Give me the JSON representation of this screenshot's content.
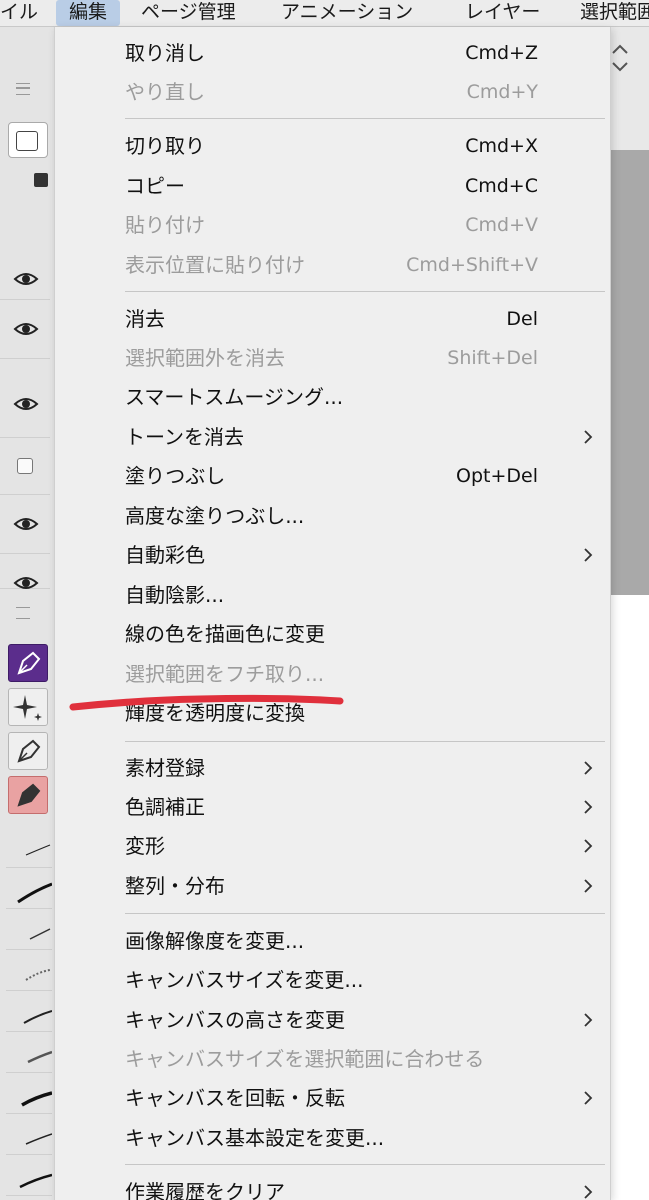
{
  "menubar": {
    "items": [
      {
        "label": "イル"
      },
      {
        "label": "編集",
        "active": true
      },
      {
        "label": "ページ管理"
      },
      {
        "label": "アニメーション"
      },
      {
        "label": "レイヤー"
      },
      {
        "label": "選択範囲"
      }
    ]
  },
  "edit_menu": {
    "items": [
      {
        "label": "取り消し",
        "shortcut": "Cmd+Z",
        "enabled": true
      },
      {
        "label": "やり直し",
        "shortcut": "Cmd+Y",
        "enabled": false
      },
      {
        "label": "切り取り",
        "shortcut": "Cmd+X",
        "enabled": true
      },
      {
        "label": "コピー",
        "shortcut": "Cmd+C",
        "enabled": true
      },
      {
        "label": "貼り付け",
        "shortcut": "Cmd+V",
        "enabled": false
      },
      {
        "label": "表示位置に貼り付け",
        "shortcut": "Cmd+Shift+V",
        "enabled": false
      },
      {
        "label": "消去",
        "shortcut": "Del",
        "enabled": true
      },
      {
        "label": "選択範囲外を消去",
        "shortcut": "Shift+Del",
        "enabled": false
      },
      {
        "label": "スマートスムージング...",
        "enabled": true
      },
      {
        "label": "トーンを消去",
        "enabled": true,
        "submenu": true
      },
      {
        "label": "塗りつぶし",
        "shortcut": "Opt+Del",
        "enabled": true
      },
      {
        "label": "高度な塗りつぶし...",
        "enabled": true
      },
      {
        "label": "自動彩色",
        "enabled": true,
        "submenu": true
      },
      {
        "label": "自動陰影...",
        "enabled": true
      },
      {
        "label": "線の色を描画色に変更",
        "enabled": true
      },
      {
        "label": "選択範囲をフチ取り...",
        "enabled": false
      },
      {
        "label": "輝度を透明度に変換",
        "enabled": true
      },
      {
        "label": "素材登録",
        "enabled": true,
        "submenu": true
      },
      {
        "label": "色調補正",
        "enabled": true,
        "submenu": true
      },
      {
        "label": "変形",
        "enabled": true,
        "submenu": true
      },
      {
        "label": "整列・分布",
        "enabled": true,
        "submenu": true
      },
      {
        "label": "画像解像度を変更...",
        "enabled": true
      },
      {
        "label": "キャンバスサイズを変更...",
        "enabled": true
      },
      {
        "label": "キャンバスの高さを変更",
        "enabled": true,
        "submenu": true
      },
      {
        "label": "キャンバスサイズを選択範囲に合わせる",
        "enabled": false
      },
      {
        "label": "キャンバスを回転・反転",
        "enabled": true,
        "submenu": true
      },
      {
        "label": "キャンバス基本設定を変更...",
        "enabled": true
      },
      {
        "label": "作業履歴をクリア",
        "enabled": true,
        "submenu": true
      }
    ]
  },
  "annotation": {
    "color": "#e0303c"
  },
  "colors": {
    "menu_bg": "#efefef",
    "menubar_active": "#b9cde6",
    "tool_selected": "#5b2d8c",
    "tool_highlight": "#e9a2a2"
  }
}
